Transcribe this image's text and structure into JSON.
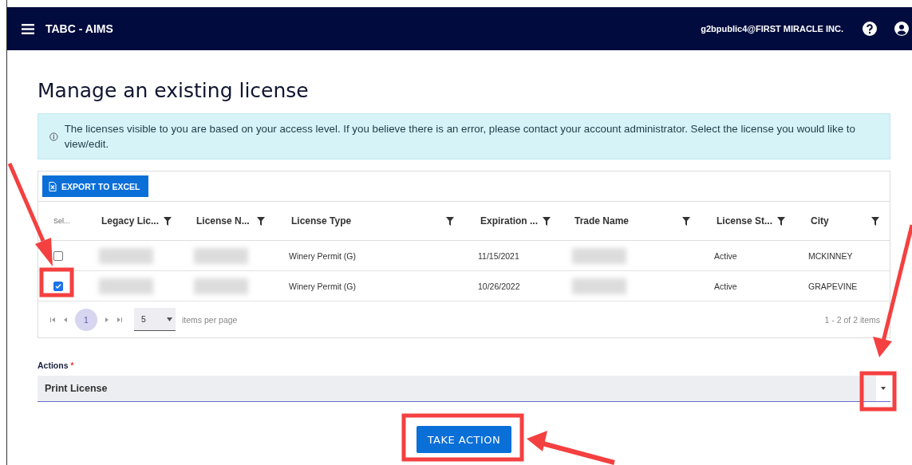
{
  "header": {
    "app_title": "TABC - AIMS",
    "user": "g2bpublic4@FIRST MIRACLE INC."
  },
  "page_title": "Manage an existing license",
  "notice": "The licenses visible to you are based on your access level. If you believe there is an error, please contact your account administrator. Select the license you would like to view/edit.",
  "grid": {
    "export_button": "EXPORT TO EXCEL",
    "columns": [
      {
        "label": "Sel...",
        "kind": "select"
      },
      {
        "label": "Legacy Lic...",
        "kind": "filter"
      },
      {
        "label": "License N...",
        "kind": "filter"
      },
      {
        "label": "License Type",
        "kind": "filter"
      },
      {
        "label": "Expiration ...",
        "kind": "filter"
      },
      {
        "label": "Trade Name",
        "kind": "filter"
      },
      {
        "label": "License St...",
        "kind": "filter"
      },
      {
        "label": "City",
        "kind": "filter"
      }
    ],
    "rows": [
      {
        "selected": false,
        "cells": [
          {
            "kind": "checkbox"
          },
          {
            "kind": "blurred"
          },
          {
            "kind": "blurred"
          },
          {
            "kind": "text",
            "text": "Winery Permit (G)"
          },
          {
            "kind": "text",
            "text": "11/15/2021"
          },
          {
            "kind": "blurred"
          },
          {
            "kind": "text",
            "text": "Active"
          },
          {
            "kind": "text",
            "text": "MCKINNEY"
          }
        ]
      },
      {
        "selected": true,
        "cells": [
          {
            "kind": "checkbox"
          },
          {
            "kind": "blurred"
          },
          {
            "kind": "blurred"
          },
          {
            "kind": "text",
            "text": "Winery Permit (G)"
          },
          {
            "kind": "text",
            "text": "10/26/2022"
          },
          {
            "kind": "blurred"
          },
          {
            "kind": "text",
            "text": "Active"
          },
          {
            "kind": "text",
            "text": "GRAPEVINE"
          }
        ]
      }
    ],
    "pager": {
      "pages": [
        {
          "label": "1",
          "selected": true
        }
      ],
      "page_size": "5",
      "page_size_label": "items per page",
      "summary": "1 - 2 of 2 items"
    }
  },
  "actions": {
    "label": "Actions",
    "required_mark": "*",
    "value": "Print License"
  },
  "submit_button": "TAKE ACTION"
}
